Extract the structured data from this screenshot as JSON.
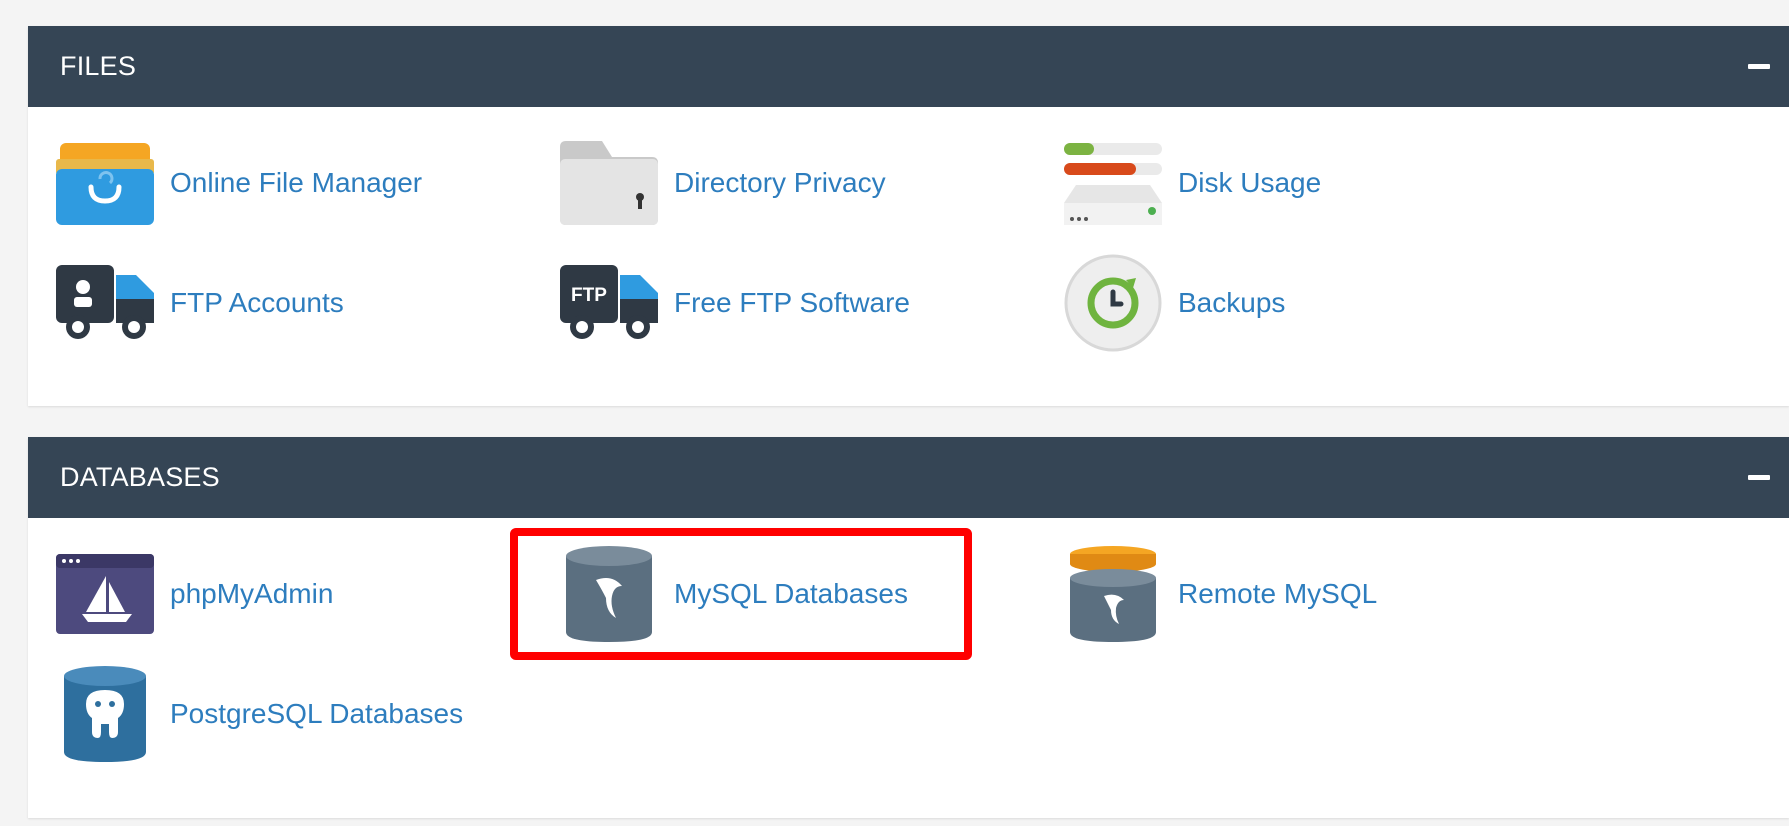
{
  "sections": {
    "files": {
      "title": "FILES",
      "items": [
        {
          "label": "Online File Manager",
          "icon": "file-manager-icon"
        },
        {
          "label": "Directory Privacy",
          "icon": "directory-privacy-icon"
        },
        {
          "label": "Disk Usage",
          "icon": "disk-usage-icon"
        },
        {
          "label": "FTP Accounts",
          "icon": "ftp-accounts-icon"
        },
        {
          "label": "Free FTP Software",
          "icon": "free-ftp-icon"
        },
        {
          "label": "Backups",
          "icon": "backups-icon"
        }
      ]
    },
    "databases": {
      "title": "DATABASES",
      "items": [
        {
          "label": "phpMyAdmin",
          "icon": "phpmyadmin-icon"
        },
        {
          "label": "MySQL Databases",
          "icon": "mysql-icon"
        },
        {
          "label": "Remote MySQL",
          "icon": "remote-mysql-icon"
        },
        {
          "label": "PostgreSQL Databases",
          "icon": "postgresql-icon"
        }
      ]
    }
  },
  "ftp_icon_text": "FTP",
  "colors": {
    "header_bg": "#354555",
    "link": "#2d7dbe",
    "highlight": "#ff0000"
  }
}
